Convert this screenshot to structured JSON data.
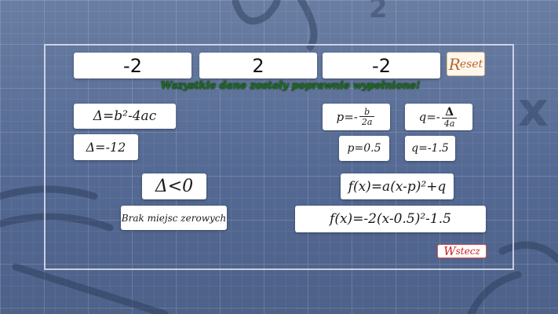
{
  "coefficients": {
    "a": "-2",
    "b": "2",
    "c": "-2"
  },
  "reset_button": {
    "cap": "R",
    "rest": "eset"
  },
  "message": "Wszystkie dane zostały poprawnie wypełnione!",
  "formulas": {
    "delta_formula": "Δ=b²-4ac",
    "delta_value": "Δ=-12",
    "delta_condition": "Δ<0",
    "no_roots": "Brak miejsc zerowych",
    "p_prefix": "p=-",
    "p_num": "b",
    "p_den": "2a",
    "q_prefix": "q=-",
    "q_num": "Δ",
    "q_den": "4a",
    "p_value": "p=0.5",
    "q_value": "q=-1.5",
    "vertex_form": "f(x)=a(x-p)²+q",
    "vertex_result": "f(x)=-2(x-0.5)²-1.5"
  },
  "next_button": {
    "cap": "W",
    "rest": "stecz"
  }
}
